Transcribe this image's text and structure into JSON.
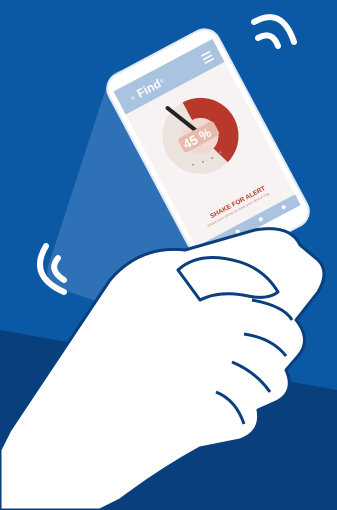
{
  "app": {
    "title": "Find",
    "title_suffix": "it",
    "back_icon": "back-arrows-icon",
    "menu_icon": "menu-icon"
  },
  "gauge": {
    "value_label": "45 %",
    "level_fraction": 0.45
  },
  "alert": {
    "label": "SHAKE FOR ALERT",
    "subtext": "Shake your phone to make your device ring"
  },
  "bottom_bar": {
    "icons": [
      "back-icon",
      "home-icon",
      "recent-icon",
      "settings-icon"
    ]
  },
  "colors": {
    "background_top": "#0b58a5",
    "background_bottom": "#0a3f7e",
    "phone_frame": "#ffffff",
    "screen_header": "#a9c3e0",
    "gauge_red": "#b8392c",
    "gauge_track": "#e8ddd9",
    "alert_red": "#c0392b",
    "hand": "#ffffff",
    "hand_outline": "#0a3f7e"
  }
}
